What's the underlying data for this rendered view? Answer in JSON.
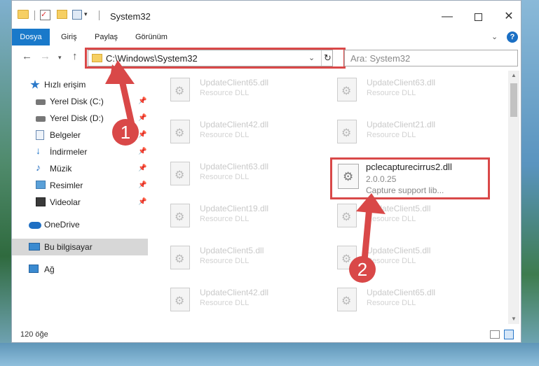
{
  "window": {
    "title": "System32",
    "controls": {
      "minimize": "—",
      "maximize": "",
      "close": "✕"
    }
  },
  "ribbon": {
    "tabs": [
      "Dosya",
      "Giriş",
      "Paylaş",
      "Görünüm"
    ],
    "help": "?"
  },
  "address": {
    "path": "C:\\Windows\\System32",
    "search_placeholder": "Ara: System32"
  },
  "nav": {
    "items": [
      {
        "label": "Hızlı erişim",
        "icon": "star-icon"
      },
      {
        "label": "Yerel Disk (C:)",
        "icon": "drive-icon",
        "pinned": true
      },
      {
        "label": "Yerel Disk (D:)",
        "icon": "drive-icon",
        "pinned": true
      },
      {
        "label": "Belgeler",
        "icon": "document-icon",
        "pinned": true
      },
      {
        "label": "İndirmeler",
        "icon": "download-icon",
        "pinned": true
      },
      {
        "label": "Müzik",
        "icon": "music-icon",
        "pinned": true
      },
      {
        "label": "Resimler",
        "icon": "pictures-icon",
        "pinned": true
      },
      {
        "label": "Videolar",
        "icon": "video-icon",
        "pinned": true
      },
      {
        "label": "OneDrive",
        "icon": "cloud-icon"
      },
      {
        "label": "Bu bilgisayar",
        "icon": "computer-icon",
        "selected": true
      },
      {
        "label": "Ağ",
        "icon": "network-icon"
      }
    ]
  },
  "files": [
    {
      "name": "UpdateClient65.dll",
      "desc": "Resource DLL"
    },
    {
      "name": "UpdateClient63.dll",
      "desc": "Resource DLL"
    },
    {
      "name": "UpdateClient42.dll",
      "desc": "Resource DLL"
    },
    {
      "name": "UpdateClient21.dll",
      "desc": "Resource DLL"
    },
    {
      "name": "UpdateClient63.dll",
      "desc": "Resource DLL"
    },
    {
      "name": "UpdateClient19.dll",
      "desc": "Resource DLL"
    },
    {
      "name": "UpdateClient5.dll",
      "desc": "Resource DLL"
    },
    {
      "name": "UpdateClient5.dll",
      "desc": "Resource DLL"
    },
    {
      "name": "UpdateClient5.dll",
      "desc": "Resource DLL"
    },
    {
      "name": "UpdateClient42.dll",
      "desc": "Resource DLL"
    },
    {
      "name": "UpdateClient65.dll",
      "desc": "Resource DLL"
    }
  ],
  "highlighted_file": {
    "name": "pclecapturecirrus2.dll",
    "version": "2.0.0.25",
    "desc": "Capture support lib..."
  },
  "status": {
    "count": "120 öğe"
  },
  "callouts": {
    "one": "1",
    "two": "2"
  },
  "colors": {
    "accent": "#1979ca",
    "callout": "#d94848"
  }
}
